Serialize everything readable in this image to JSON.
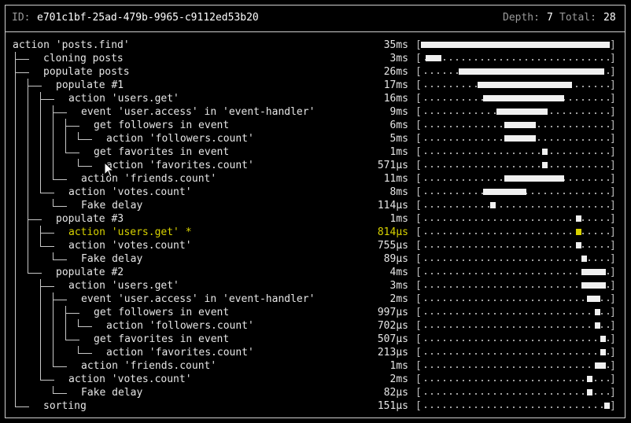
{
  "header": {
    "id_label": "ID:",
    "id_value": "e701c1bf-25ad-479b-9965-c9112ed53b20",
    "depth_label": "Depth:",
    "depth_value": "7",
    "total_label": "Total:",
    "total_value": "28"
  },
  "rows": [
    {
      "label": "action 'posts.find'",
      "depth": 0,
      "duration": "35ms",
      "start": 0.0,
      "end": 1.0
    },
    {
      "label": "cloning posts",
      "depth": 1,
      "duration": "3ms",
      "start": 0.025,
      "end": 0.11
    },
    {
      "label": "populate posts",
      "depth": 1,
      "duration": "26ms",
      "start": 0.2,
      "end": 0.97
    },
    {
      "label": "populate #1",
      "depth": 2,
      "duration": "17ms",
      "start": 0.3,
      "end": 0.8
    },
    {
      "label": "action 'users.get'",
      "depth": 3,
      "duration": "16ms",
      "start": 0.33,
      "end": 0.76
    },
    {
      "label": "event 'user.access' in 'event-handler'",
      "depth": 4,
      "duration": "9ms",
      "start": 0.4,
      "end": 0.67
    },
    {
      "label": "get followers in event",
      "depth": 5,
      "duration": "6ms",
      "start": 0.44,
      "end": 0.61
    },
    {
      "label": "action 'followers.count'",
      "depth": 6,
      "duration": "5ms",
      "start": 0.44,
      "end": 0.61
    },
    {
      "label": "get favorites in event",
      "depth": 5,
      "duration": "1ms",
      "start": 0.64,
      "end": 0.67
    },
    {
      "label": "action 'favorites.count'",
      "depth": 6,
      "duration": "571µs",
      "start": 0.64,
      "end": 0.67
    },
    {
      "label": "action 'friends.count'",
      "depth": 4,
      "duration": "11ms",
      "start": 0.44,
      "end": 0.76
    },
    {
      "label": "action 'votes.count'",
      "depth": 3,
      "duration": "8ms",
      "start": 0.33,
      "end": 0.56
    },
    {
      "label": "Fake delay",
      "depth": 4,
      "duration": "114µs",
      "start": 0.365,
      "end": 0.395
    },
    {
      "label": "populate #3",
      "depth": 2,
      "duration": "1ms",
      "start": 0.82,
      "end": 0.85
    },
    {
      "label": "action 'users.get' *",
      "depth": 3,
      "duration": "814µs",
      "start": 0.82,
      "end": 0.85,
      "highlight": true
    },
    {
      "label": "action 'votes.count'",
      "depth": 3,
      "duration": "755µs",
      "start": 0.82,
      "end": 0.85
    },
    {
      "label": "Fake delay",
      "depth": 4,
      "duration": "89µs",
      "start": 0.85,
      "end": 0.88
    },
    {
      "label": "populate #2",
      "depth": 2,
      "duration": "4ms",
      "start": 0.85,
      "end": 0.98
    },
    {
      "label": "action 'users.get'",
      "depth": 3,
      "duration": "3ms",
      "start": 0.85,
      "end": 0.98
    },
    {
      "label": "event 'user.access' in 'event-handler'",
      "depth": 4,
      "duration": "2ms",
      "start": 0.88,
      "end": 0.95
    },
    {
      "label": "get followers in event",
      "depth": 5,
      "duration": "997µs",
      "start": 0.92,
      "end": 0.95
    },
    {
      "label": "action 'followers.count'",
      "depth": 6,
      "duration": "702µs",
      "start": 0.92,
      "end": 0.95
    },
    {
      "label": "get favorites in event",
      "depth": 5,
      "duration": "507µs",
      "start": 0.95,
      "end": 0.98
    },
    {
      "label": "action 'favorites.count'",
      "depth": 6,
      "duration": "213µs",
      "start": 0.95,
      "end": 0.98
    },
    {
      "label": "action 'friends.count'",
      "depth": 4,
      "duration": "1ms",
      "start": 0.92,
      "end": 0.98
    },
    {
      "label": "action 'votes.count'",
      "depth": 3,
      "duration": "2ms",
      "start": 0.88,
      "end": 0.91
    },
    {
      "label": "Fake delay",
      "depth": 4,
      "duration": "82µs",
      "start": 0.88,
      "end": 0.91
    },
    {
      "label": "sorting",
      "depth": 1,
      "duration": "151µs",
      "start": 0.97,
      "end": 1.0
    }
  ],
  "colors": {
    "background": "#000000",
    "text": "#e6e6e6",
    "highlight": "#d8d200",
    "bar": "#f0f0f0",
    "border": "#cfcfcf"
  }
}
